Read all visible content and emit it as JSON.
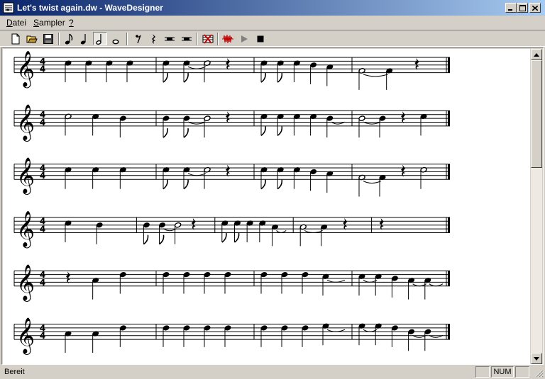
{
  "window": {
    "title": "Let's twist again.dw - WaveDesigner",
    "controls": [
      "minimize-icon",
      "maximize-icon",
      "close-icon"
    ]
  },
  "menu": {
    "items": [
      {
        "label": "Datei",
        "accel": "D"
      },
      {
        "label": "Sampler",
        "accel": "S"
      },
      {
        "label": "?",
        "accel": "?"
      }
    ]
  },
  "toolbar": {
    "buttons": [
      "new-icon",
      "open-icon",
      "save-icon",
      "eighth-note-icon",
      "quarter-note-icon",
      "half-note-icon",
      "whole-note-icon",
      "eighth-rest-icon",
      "quarter-rest-icon",
      "half-rest-icon",
      "whole-rest-icon",
      "delete-icon",
      "waveform-icon",
      "play-icon",
      "stop-icon"
    ],
    "pressed": "half-note-icon"
  },
  "score": {
    "time_signature": "4/4",
    "systems": [
      [
        [
          "q:B",
          "q:B",
          "q:B",
          "q:B"
        ],
        [
          "e:B",
          "e:B~",
          "h:B",
          "r:q"
        ],
        [
          "e:B",
          "e:B",
          "q:B",
          "q:A",
          "q:G"
        ],
        [
          "h:E~",
          "q:E",
          "r:q"
        ]
      ],
      [
        [
          "h:B",
          "q:B",
          "q:A"
        ],
        [
          "e:A",
          "e:A~",
          "h:A",
          "r:q"
        ],
        [
          "e:B",
          "e:B",
          "q:B",
          "q:B",
          "q:A~"
        ],
        [
          "h:A~",
          "q:A",
          "r:q",
          "q:B"
        ]
      ],
      [
        [
          "q:B",
          "q:B",
          "q:B"
        ],
        [
          "e:B",
          "e:B~",
          "h:B",
          "r:q"
        ],
        [
          "e:B",
          "e:B",
          "q:B",
          "q:A",
          "q:G"
        ],
        [
          "h:E~",
          "q:E",
          "r:q",
          "h:B"
        ]
      ],
      [
        [
          "q:B",
          "q:A"
        ],
        [
          "e:A",
          "e:A~",
          "h:A",
          "r:q"
        ],
        [
          "e:B",
          "e:B",
          "q:B",
          "q:B",
          "q:G~"
        ],
        [
          "h:G~",
          "q:G",
          "r:q"
        ],
        [
          "r:q"
        ]
      ],
      [
        [
          "r:q",
          "q:G",
          "q:C5"
        ],
        [
          "q:C5",
          "q:C5",
          "q:C5",
          "q:C5"
        ],
        [
          "q:C5",
          "q:C5",
          "q:C5",
          "q:B~"
        ],
        [
          "q:B~",
          "q:B",
          "q:A",
          "q:G~",
          "q:G~"
        ]
      ],
      [
        [
          "q:G",
          "q:G",
          "q:C5"
        ],
        [
          "q:C5",
          "q:C5",
          "q:C5",
          "q:C5"
        ],
        [
          "q:C5",
          "q:C5",
          "q:C5",
          "q:D5~"
        ],
        [
          "q:D5~",
          "q:D5",
          "q:C5",
          "q:A~",
          "q:A~"
        ]
      ]
    ]
  },
  "status": {
    "ready": "Bereit",
    "num": "NUM"
  },
  "colors": {
    "title_active_start": "#0a246a",
    "title_active_end": "#a6caf0",
    "face": "#d4d0c8",
    "waveform_red": "#c00000"
  }
}
